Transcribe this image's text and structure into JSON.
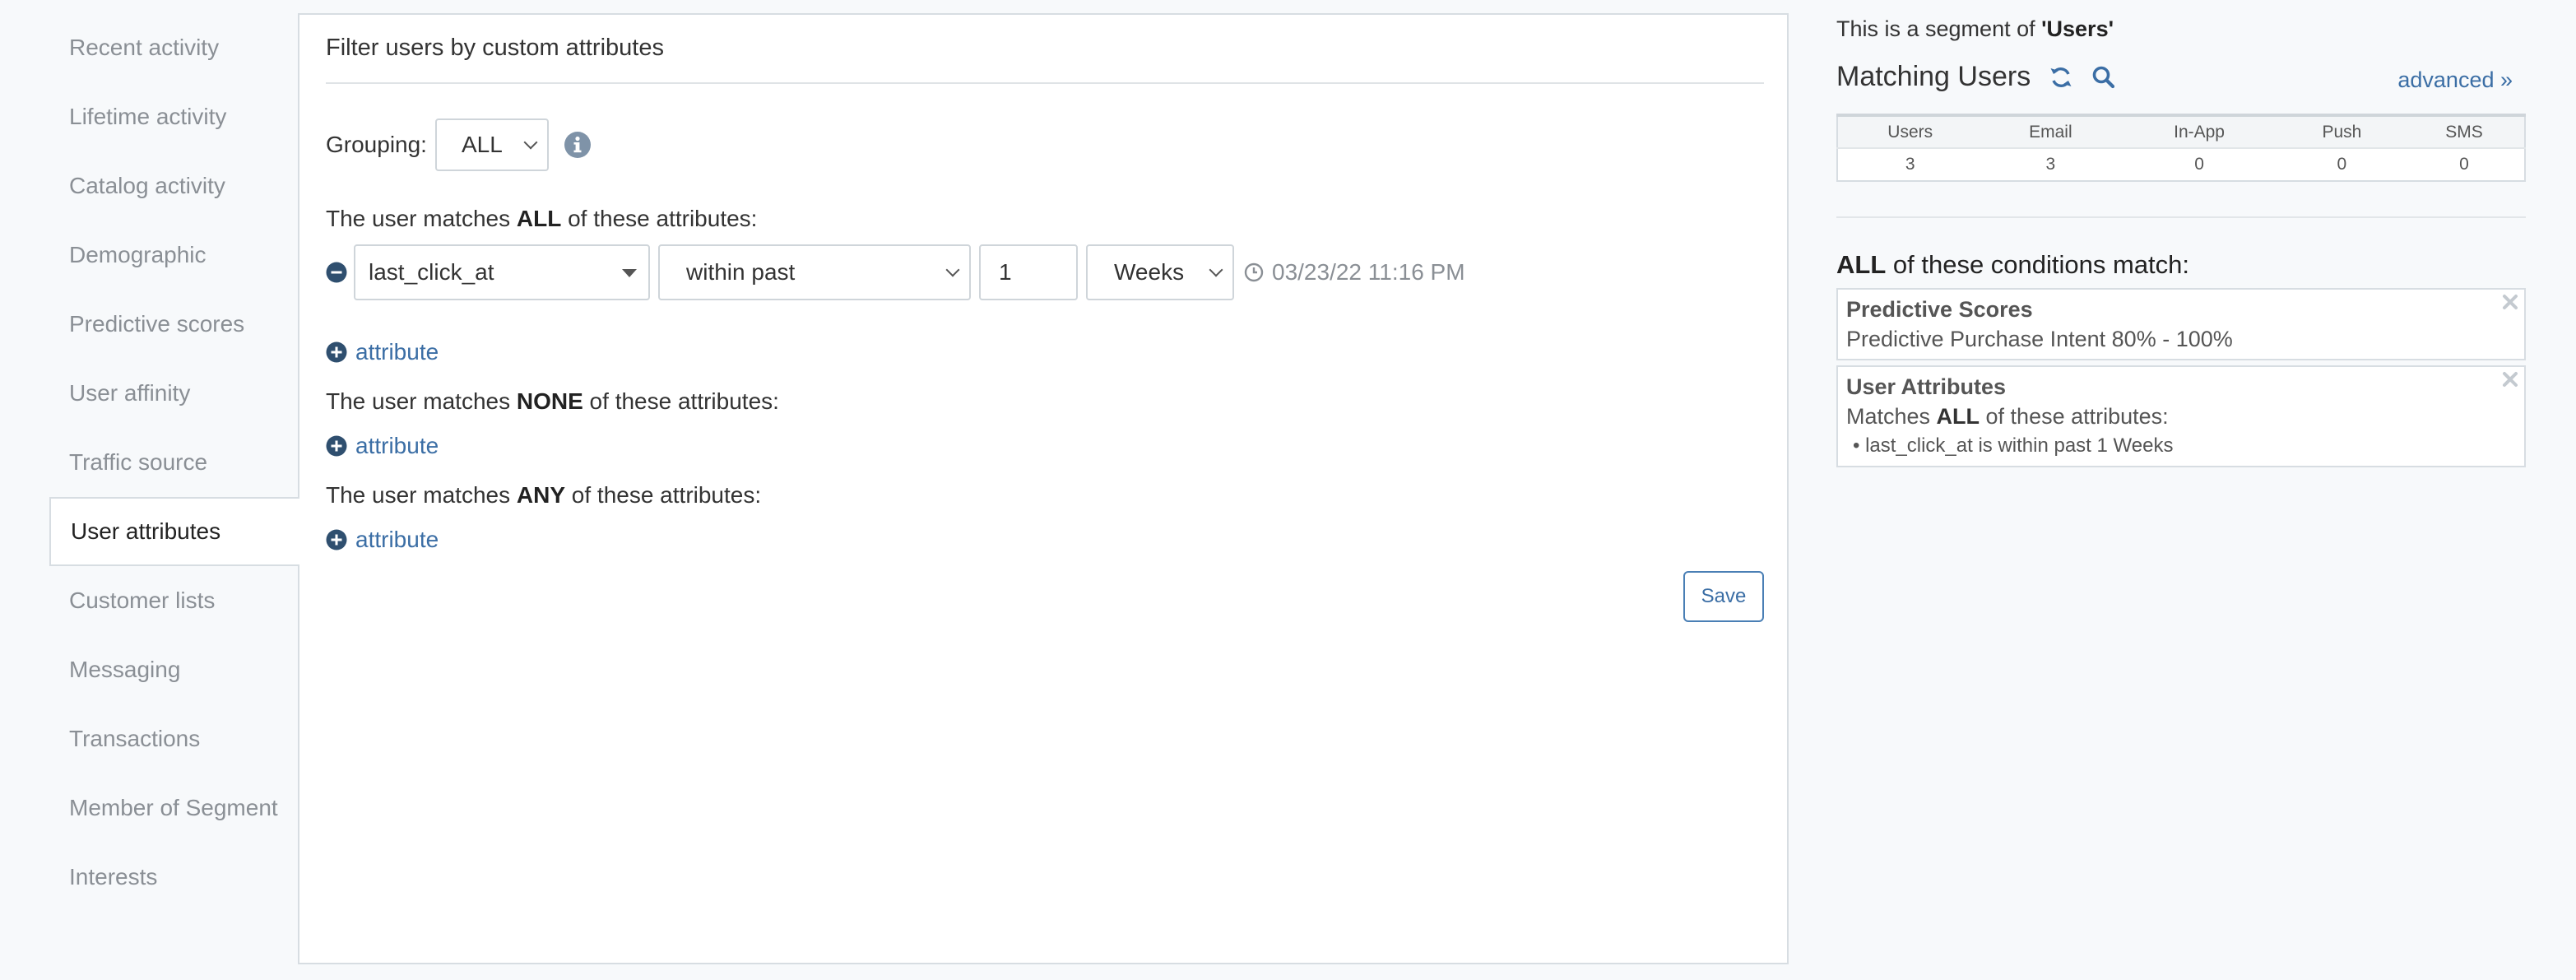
{
  "sidebar": {
    "items": [
      {
        "label": "Recent activity"
      },
      {
        "label": "Lifetime activity"
      },
      {
        "label": "Catalog activity"
      },
      {
        "label": "Demographic"
      },
      {
        "label": "Predictive scores"
      },
      {
        "label": "User affinity"
      },
      {
        "label": "Traffic source"
      },
      {
        "label": "User attributes",
        "active": true
      },
      {
        "label": "Customer lists"
      },
      {
        "label": "Messaging"
      },
      {
        "label": "Transactions"
      },
      {
        "label": "Member of Segment"
      },
      {
        "label": "Interests"
      }
    ]
  },
  "filter": {
    "title": "Filter users by custom attributes",
    "grouping_label": "Grouping:",
    "grouping_value": "ALL",
    "all_section": {
      "prefix": "The user matches ",
      "keyword": "ALL",
      "suffix": " of these attributes:"
    },
    "none_section": {
      "prefix": "The user matches ",
      "keyword": "NONE",
      "suffix": " of these attributes:"
    },
    "any_section": {
      "prefix": "The user matches ",
      "keyword": "ANY",
      "suffix": " of these attributes:"
    },
    "row": {
      "attribute": "last_click_at",
      "operator": "within past",
      "amount": "1",
      "unit": "Weeks",
      "timestamp": "03/23/22 11:16 PM"
    },
    "add_attribute_label": "attribute",
    "save_label": "Save"
  },
  "summary": {
    "segment_prefix": "This is a segment of ",
    "segment_name": "'Users'",
    "title": "Matching Users",
    "advanced_label": "advanced »",
    "stats": {
      "headers": [
        "Users",
        "Email",
        "In-App",
        "Push",
        "SMS"
      ],
      "values": [
        "3",
        "3",
        "0",
        "0",
        "0"
      ]
    },
    "conditions_keyword": "ALL",
    "conditions_suffix": " of these conditions match:",
    "cards": [
      {
        "title": "Predictive Scores",
        "detail": "Predictive Purchase Intent 80% - 100%"
      },
      {
        "title": "User Attributes",
        "detail_prefix": "Matches ",
        "detail_keyword": "ALL",
        "detail_suffix": " of these attributes:",
        "bullet": "• last_click_at is within past 1 Weeks"
      }
    ]
  },
  "colors": {
    "accent": "#3b6ea5",
    "muted": "#8a8f95",
    "border": "#d7dde2"
  }
}
